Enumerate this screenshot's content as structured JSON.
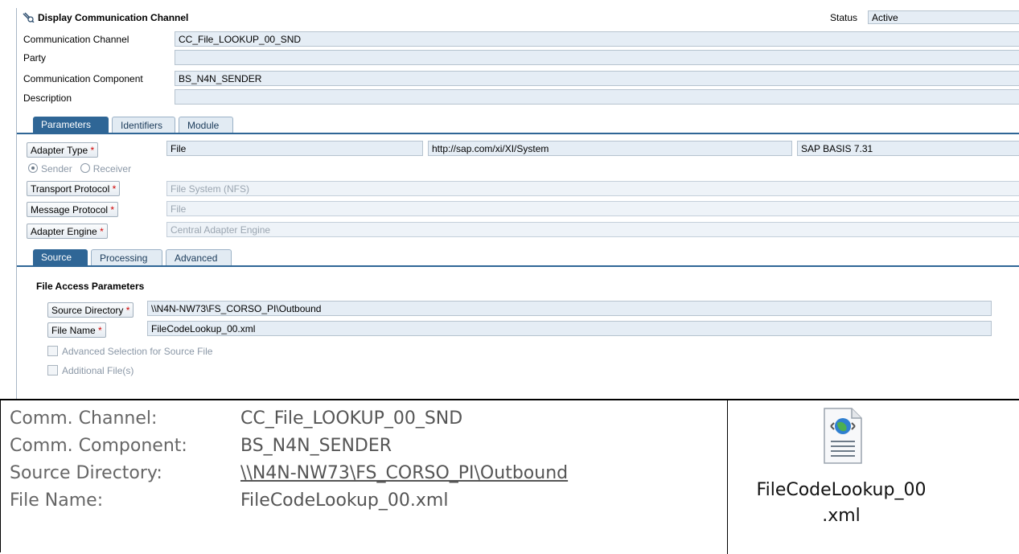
{
  "header": {
    "title": "Display Communication Channel",
    "status_label": "Status",
    "status_value": "Active"
  },
  "fields": [
    {
      "label": "Communication Channel",
      "value": "CC_File_LOOKUP_00_SND"
    },
    {
      "label": "Party",
      "value": ""
    },
    {
      "label": "Communication Component",
      "value": "BS_N4N_SENDER"
    },
    {
      "label": "Description",
      "value": ""
    }
  ],
  "main_tabs": [
    {
      "label": "Parameters",
      "active": true
    },
    {
      "label": "Identifiers",
      "active": false
    },
    {
      "label": "Module",
      "active": false
    }
  ],
  "parameters": {
    "adapter_type_label": "Adapter Type",
    "adapter_type_value": "File",
    "adapter_namespace": "http://sap.com/xi/XI/System",
    "adapter_swcv": "SAP BASIS 7.31",
    "radio_sender": "Sender",
    "radio_receiver": "Receiver",
    "transport_protocol_label": "Transport Protocol",
    "transport_protocol_value": "File System (NFS)",
    "message_protocol_label": "Message Protocol",
    "message_protocol_value": "File",
    "adapter_engine_label": "Adapter Engine",
    "adapter_engine_value": "Central Adapter Engine",
    "required_mark": "*"
  },
  "sub_tabs": [
    {
      "label": "Source",
      "active": true
    },
    {
      "label": "Processing",
      "active": false
    },
    {
      "label": "Advanced",
      "active": false
    }
  ],
  "source": {
    "group_title": "File Access Parameters",
    "source_directory_label": "Source Directory",
    "source_directory_value": "\\\\N4N-NW73\\FS_CORSO_PI\\Outbound",
    "file_name_label": "File Name",
    "file_name_value": "FileCodeLookup_00.xml",
    "advanced_selection_label": "Advanced Selection for Source File",
    "additional_files_label": "Additional File(s)"
  },
  "summary": [
    {
      "key": "Comm. Channel:",
      "value": "CC_File_LOOKUP_00_SND",
      "link": false
    },
    {
      "key": "Comm. Component:",
      "value": "BS_N4N_SENDER",
      "link": false
    },
    {
      "key": "Source Directory:",
      "value": "\\\\N4N-NW73\\FS_CORSO_PI\\Outbound",
      "link": true
    },
    {
      "key": "File Name:",
      "value": "FileCodeLookup_00.xml",
      "link": false
    }
  ],
  "attachment": {
    "icon": "xml-file-icon",
    "name_line1": "FileCodeLookup_00",
    "name_line2": ".xml"
  },
  "colors": {
    "tab_active": "#2f6696",
    "field_bg": "#e5edf5",
    "link": "#1a6fc4",
    "required": "#d00000"
  }
}
